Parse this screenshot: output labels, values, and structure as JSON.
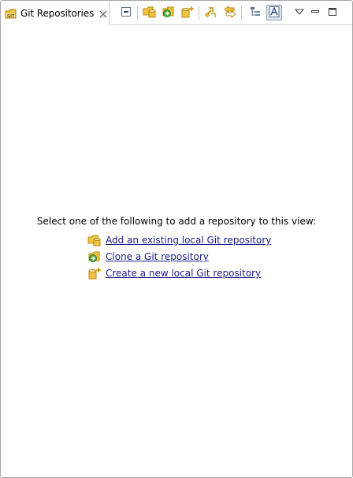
{
  "view": {
    "tab_label": "Git Repositories",
    "icons": {
      "tab": "git-repositories-icon",
      "close": "close-icon"
    }
  },
  "toolbar": {
    "buttons": [
      {
        "name": "collapse-all-button",
        "icon": "collapse-all-icon"
      },
      {
        "name": "add-existing-repo-button",
        "icon": "add-repository-icon"
      },
      {
        "name": "clone-repo-button",
        "icon": "clone-repository-icon"
      },
      {
        "name": "create-repo-button",
        "icon": "create-repository-icon"
      },
      {
        "name": "link-with-selection-button",
        "icon": "link-selection-icon"
      },
      {
        "name": "link-with-editor-button",
        "icon": "link-editor-icon"
      },
      {
        "name": "hierarchical-layout-button",
        "icon": "hierarchy-icon"
      },
      {
        "name": "show-annotations-button",
        "icon": "text-annotation-icon"
      },
      {
        "name": "view-menu-button",
        "icon": "chevron-down-icon"
      },
      {
        "name": "minimize-button",
        "icon": "minimize-icon"
      },
      {
        "name": "maximize-button",
        "icon": "maximize-icon"
      }
    ]
  },
  "content": {
    "intro": "Select one of the following to add a repository to this view:",
    "links": [
      {
        "label": "Add an existing local Git repository",
        "icon": "add-repository-icon"
      },
      {
        "label": "Clone a Git repository",
        "icon": "clone-repository-icon"
      },
      {
        "label": "Create a new local Git repository",
        "icon": "create-repository-icon"
      }
    ]
  },
  "colors": {
    "link": "#1a1a8c",
    "folder": "#f2c33f",
    "green": "#3f9a2f",
    "accent": "#d98c00",
    "border": "#a6a6a6"
  }
}
